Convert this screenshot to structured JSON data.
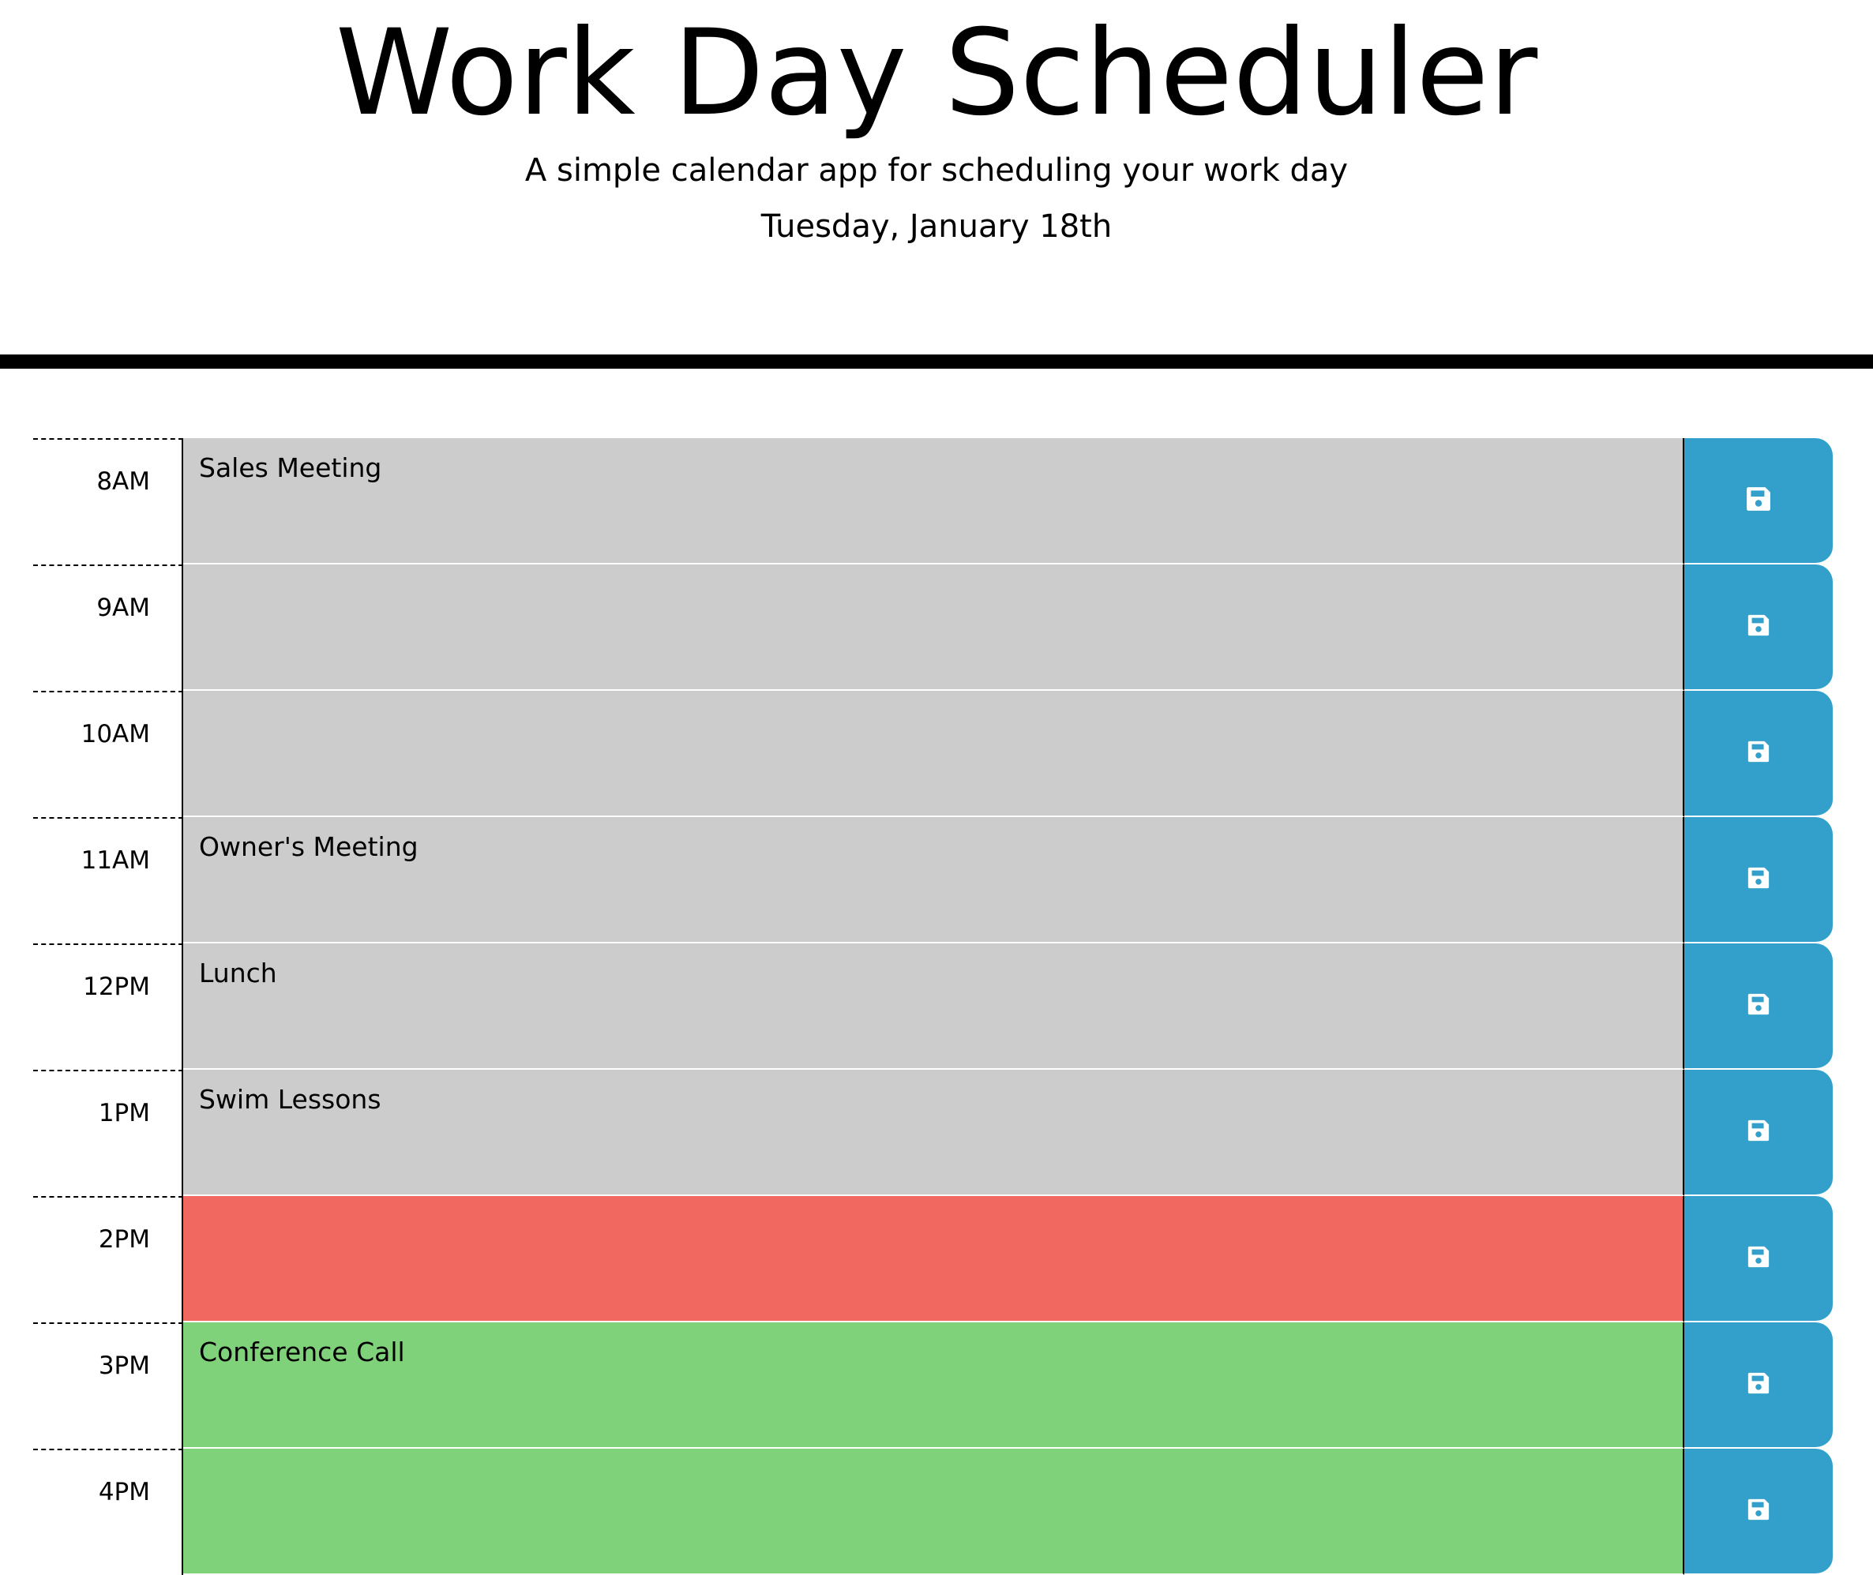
{
  "header": {
    "title": "Work Day Scheduler",
    "subtitle": "A simple calendar app for scheduling your work day",
    "current_day": "Tuesday, January 18th"
  },
  "colors": {
    "past": "#cccccc",
    "present": "#f0685f",
    "future": "#80d27a",
    "save_button": "#33a0cc"
  },
  "save_icon": "floppy-disk-icon",
  "time_blocks": [
    {
      "hour": "8AM",
      "description": "Sales Meeting",
      "status": "past"
    },
    {
      "hour": "9AM",
      "description": "",
      "status": "past"
    },
    {
      "hour": "10AM",
      "description": "",
      "status": "past"
    },
    {
      "hour": "11AM",
      "description": "Owner's Meeting",
      "status": "past"
    },
    {
      "hour": "12PM",
      "description": "Lunch",
      "status": "past"
    },
    {
      "hour": "1PM",
      "description": "Swim Lessons",
      "status": "past"
    },
    {
      "hour": "2PM",
      "description": "",
      "status": "present"
    },
    {
      "hour": "3PM",
      "description": "Conference Call",
      "status": "future"
    },
    {
      "hour": "4PM",
      "description": "",
      "status": "future"
    }
  ]
}
